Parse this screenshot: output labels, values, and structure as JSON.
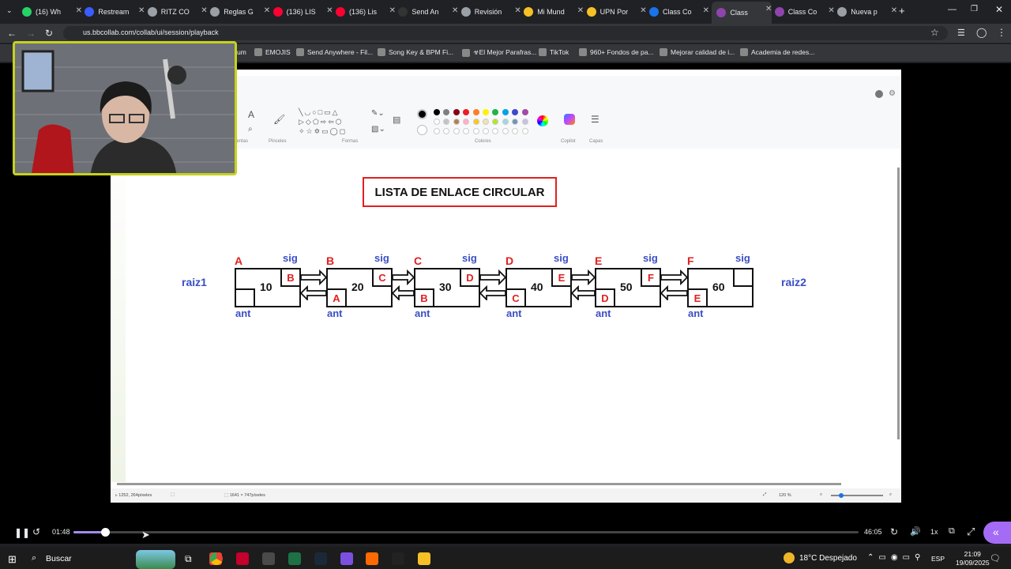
{
  "browser": {
    "tabs": [
      {
        "label": "(16) Wh",
        "color": "#25d366"
      },
      {
        "label": "Restream",
        "color": "#3b5cff"
      },
      {
        "label": "RITZ CO",
        "color": "#9aa0a6"
      },
      {
        "label": "Reglas G",
        "color": "#9aa0a6"
      },
      {
        "label": "(136) LIS",
        "color": "#ff0033"
      },
      {
        "label": "(136) Lis",
        "color": "#ff0033"
      },
      {
        "label": "Send An",
        "color": "#333333"
      },
      {
        "label": "Revisión",
        "color": "#9aa0a6"
      },
      {
        "label": "Mi Mund",
        "color": "#f6c026"
      },
      {
        "label": "UPN Por",
        "color": "#f6c026"
      },
      {
        "label": "Class Co",
        "color": "#1a73e8"
      },
      {
        "label": "Class",
        "color": "#8e44ad"
      },
      {
        "label": "Class Co",
        "color": "#8e44ad"
      },
      {
        "label": "Nueva p",
        "color": "#9aa0a6"
      }
    ],
    "url": "us.bbcollab.com/collab/ui/session/playback",
    "bookmarks": [
      "um",
      "EMOJIS",
      "Send Anywhere - Fil...",
      "Song Key & BPM Fi...",
      "☣El Mejor Parafras...",
      "TikTok",
      "960+ Fondos de pa...",
      "Mejorar calidad de i...",
      "Academia de redes..."
    ]
  },
  "paint": {
    "groups": [
      "ientas",
      "Pinceles",
      "Formas",
      "Colores",
      "Copilot",
      "Capas"
    ],
    "status": {
      "cursor": "1252, 264píxeles",
      "size": "1641 × 747píxeles",
      "zoom": "120 %"
    },
    "colors_row1": [
      "#000000",
      "#7f7f7f",
      "#880015",
      "#ed1c24",
      "#ff7f27",
      "#fff200",
      "#22b14c",
      "#00a2e8",
      "#3f48cc",
      "#a349a4"
    ],
    "colors_row2": [
      "#ffffff",
      "#c3c3c3",
      "#b97a57",
      "#ffaec9",
      "#ffc90e",
      "#efe4b0",
      "#b5e61d",
      "#99d9ea",
      "#7092be",
      "#c8bfe7"
    ]
  },
  "diagram": {
    "title": "LISTA DE ENLACE CIRCULAR",
    "raiz_left": "raiz1",
    "raiz_right": "raiz2",
    "sig_label": "sig",
    "ant_label": "ant",
    "nodes": [
      {
        "name": "A",
        "value": "10",
        "next": "B",
        "prev": ""
      },
      {
        "name": "B",
        "value": "20",
        "next": "C",
        "prev": "A"
      },
      {
        "name": "C",
        "value": "30",
        "next": "D",
        "prev": "B"
      },
      {
        "name": "D",
        "value": "40",
        "next": "E",
        "prev": "C"
      },
      {
        "name": "E",
        "value": "50",
        "next": "F",
        "prev": "D"
      },
      {
        "name": "F",
        "value": "60",
        "next": "",
        "prev": "E"
      }
    ]
  },
  "player": {
    "current_time": "01:48",
    "duration": "46:05",
    "progress": 0.04,
    "speed": "1x"
  },
  "taskbar": {
    "search": "Buscar",
    "weather": "18°C  Despejado",
    "lang": "ESP",
    "time": "21:09",
    "date": "19/09/2025"
  }
}
